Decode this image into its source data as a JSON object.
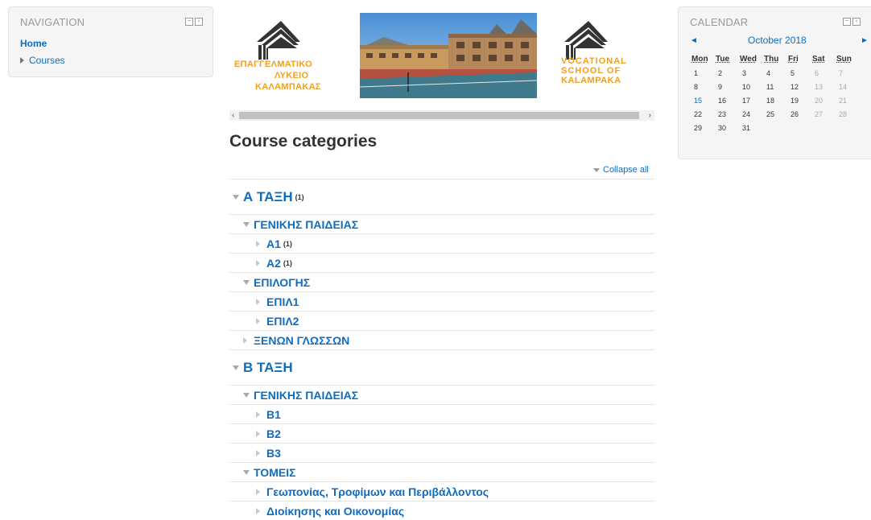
{
  "navigation": {
    "title": "NAVIGATION",
    "home": "Home",
    "courses": "Courses"
  },
  "banner": {
    "logo_gr_line1": "ΕΠΑΓΓΕΛΜΑΤΙΚΟ",
    "logo_gr_line2": "ΛΥΚΕΙΟ",
    "logo_gr_line3": "ΚΑΛΑΜΠΑΚΑΣ",
    "logo_en_line1": "VOCATIONAL",
    "logo_en_line2": "SCHOOL OF",
    "logo_en_line3": "KALAMPAKA"
  },
  "main": {
    "title": "Course categories",
    "collapse_all": "Collapse all"
  },
  "categories": [
    {
      "level": 1,
      "name": "Α ΤΑΞΗ",
      "count": "(1)",
      "expanded": true
    },
    {
      "level": 2,
      "name": "ΓΕΝΙΚΗΣ ΠΑΙΔΕΙΑΣ",
      "count": "",
      "expanded": true
    },
    {
      "level": 3,
      "name": "Α1",
      "count": "(1)",
      "expanded": false
    },
    {
      "level": 3,
      "name": "Α2",
      "count": "(1)",
      "expanded": false
    },
    {
      "level": 2,
      "name": "ΕΠΙΛΟΓΗΣ",
      "count": "",
      "expanded": true
    },
    {
      "level": 3,
      "name": "ΕΠΙΛ1",
      "count": "",
      "expanded": false
    },
    {
      "level": 3,
      "name": "ΕΠΙΛ2",
      "count": "",
      "expanded": false
    },
    {
      "level": 2,
      "name": "ΞΕΝΩΝ ΓΛΩΣΣΩΝ",
      "count": "",
      "expanded": false
    },
    {
      "level": 1,
      "name": "Β ΤΑΞΗ",
      "count": "",
      "expanded": true
    },
    {
      "level": 2,
      "name": "ΓΕΝΙΚΗΣ ΠΑΙΔΕΙΑΣ",
      "count": "",
      "expanded": true
    },
    {
      "level": 3,
      "name": "Β1",
      "count": "",
      "expanded": false
    },
    {
      "level": 3,
      "name": "Β2",
      "count": "",
      "expanded": false
    },
    {
      "level": 3,
      "name": "Β3",
      "count": "",
      "expanded": false
    },
    {
      "level": 2,
      "name": "ΤΟΜΕΙΣ",
      "count": "",
      "expanded": true
    },
    {
      "level": 3,
      "name": "Γεωπονίας, Τροφίμων και Περιβάλλοντος",
      "count": "",
      "expanded": false
    },
    {
      "level": 3,
      "name": "Διοίκησης και Οικονομίας",
      "count": "",
      "expanded": false
    }
  ],
  "calendar": {
    "title": "CALENDAR",
    "month": "October 2018",
    "prev": "◄",
    "next": "►",
    "weekdays": [
      "Mon",
      "Tue",
      "Wed",
      "Thu",
      "Fri",
      "Sat",
      "Sun"
    ],
    "weeks": [
      [
        "1",
        "2",
        "3",
        "4",
        "5",
        "6",
        "7"
      ],
      [
        "8",
        "9",
        "10",
        "11",
        "12",
        "13",
        "14"
      ],
      [
        "15",
        "16",
        "17",
        "18",
        "19",
        "20",
        "21"
      ],
      [
        "22",
        "23",
        "24",
        "25",
        "26",
        "27",
        "28"
      ],
      [
        "29",
        "30",
        "31",
        "",
        "",
        "",
        ""
      ]
    ],
    "today": "15"
  }
}
